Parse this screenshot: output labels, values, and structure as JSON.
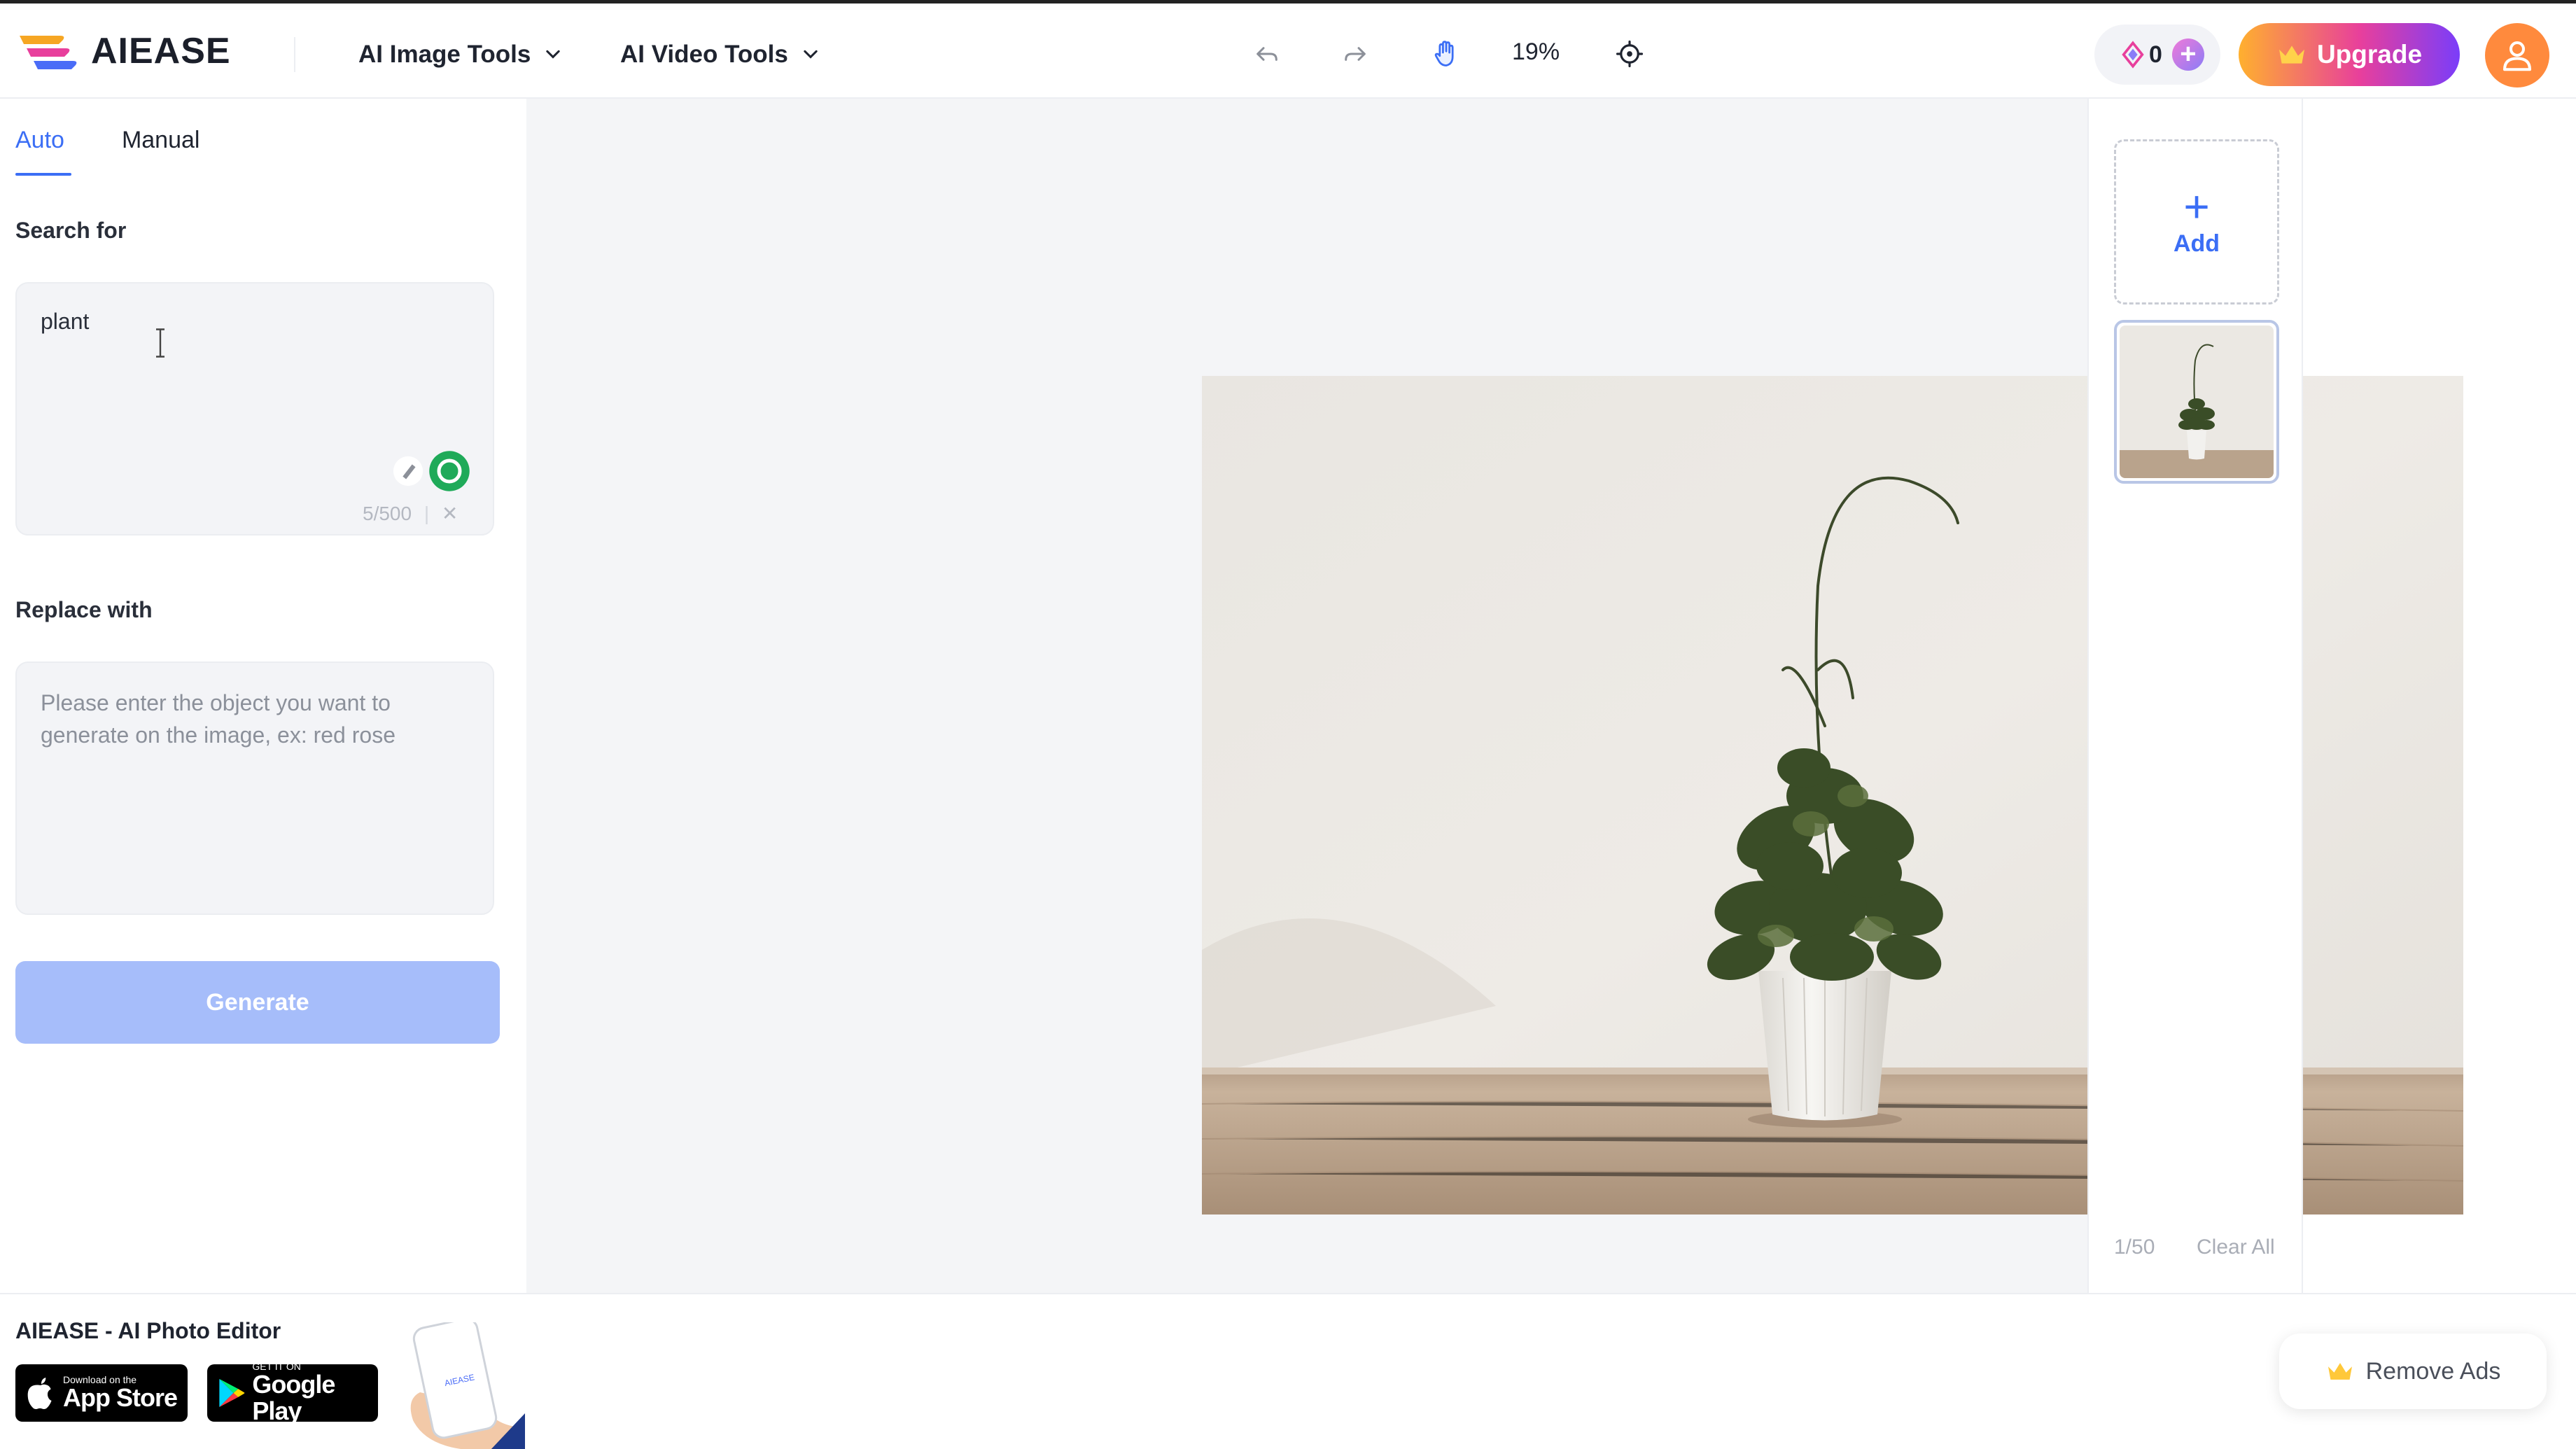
{
  "header": {
    "brand": "AIEASE",
    "menus": [
      {
        "label": "AI Image Tools"
      },
      {
        "label": "AI Video Tools"
      }
    ],
    "zoom": "19%",
    "credits": "0",
    "upgrade_label": "Upgrade",
    "accent": "#3b6ef5"
  },
  "left_panel": {
    "tabs": [
      {
        "label": "Auto",
        "active": true
      },
      {
        "label": "Manual",
        "active": false
      }
    ],
    "search": {
      "label": "Search for",
      "value": "plant",
      "counter": "5/500"
    },
    "replace": {
      "label": "Replace with",
      "placeholder": "Please enter the object you want to generate on the image, ex: red rose"
    },
    "generate_label": "Generate"
  },
  "right_panel": {
    "add_label": "Add",
    "page_count": "1/50",
    "clear_all": "Clear All"
  },
  "footer": {
    "ad_title": "AIEASE - AI Photo Editor",
    "app_store": {
      "small": "Download on the",
      "big": "App Store"
    },
    "google_play": {
      "small": "GET IT ON",
      "big": "Google Play"
    },
    "remove_ads": "Remove Ads"
  },
  "icons": [
    "brand-logo-icon",
    "chevron-down-icon",
    "undo-icon",
    "redo-icon",
    "hand-pan-icon",
    "recenter-icon",
    "credits-gem-icon",
    "add-credits-icon",
    "crown-icon",
    "user-icon",
    "text-cursor-icon",
    "eraser-icon",
    "toggle-icon",
    "clear-x-icon",
    "plus-icon",
    "apple-icon",
    "google-play-icon"
  ]
}
